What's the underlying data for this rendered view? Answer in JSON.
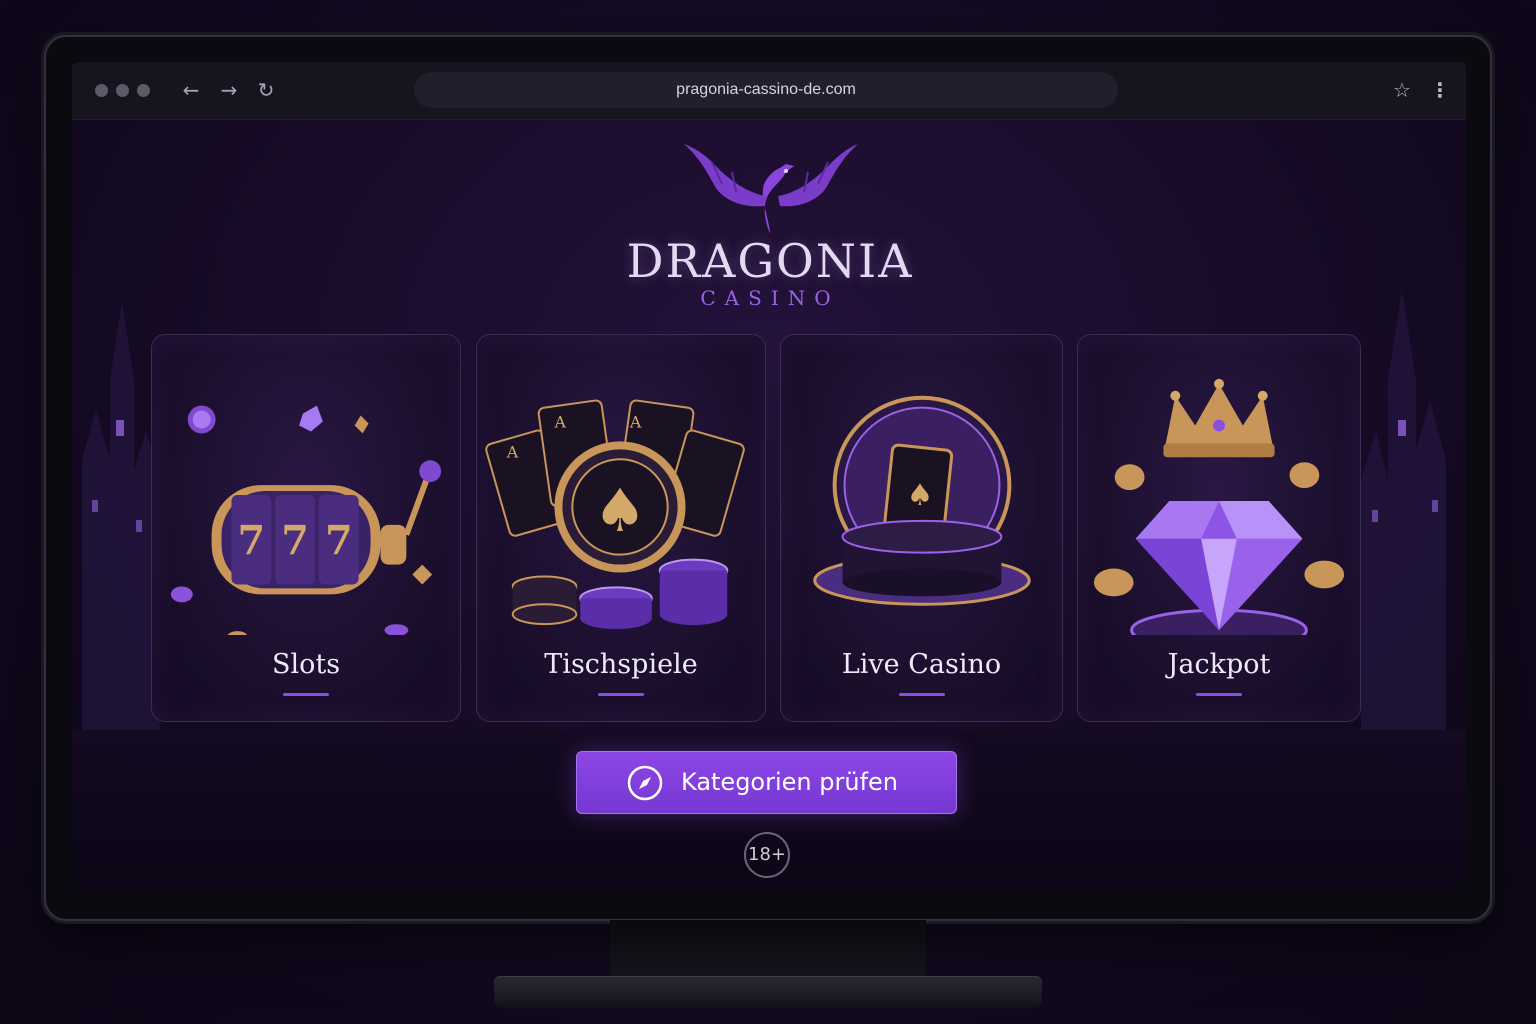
{
  "browser": {
    "url": "pragonia-cassino-de.com",
    "back_icon": "←",
    "forward_icon": "→",
    "reload_icon": "↻",
    "star_icon": "☆",
    "menu_icon": "⋮"
  },
  "brand": {
    "title": "DRAGONIA",
    "subtitle": "CASINO"
  },
  "categories": [
    {
      "label": "Slots",
      "icon": "slot-machine-icon"
    },
    {
      "label": "Tischspiele",
      "icon": "cards-and-chips-icon"
    },
    {
      "label": "Live Casino",
      "icon": "live-card-stage-icon"
    },
    {
      "label": "Jackpot",
      "icon": "crown-diamond-icon"
    }
  ],
  "cta": {
    "label": "Kategorien prüfen",
    "icon": "compass-icon"
  },
  "age_notice": "18+",
  "colors": {
    "accent": "#8a4fe0",
    "gold": "#c9965a",
    "background": "#170b27"
  }
}
